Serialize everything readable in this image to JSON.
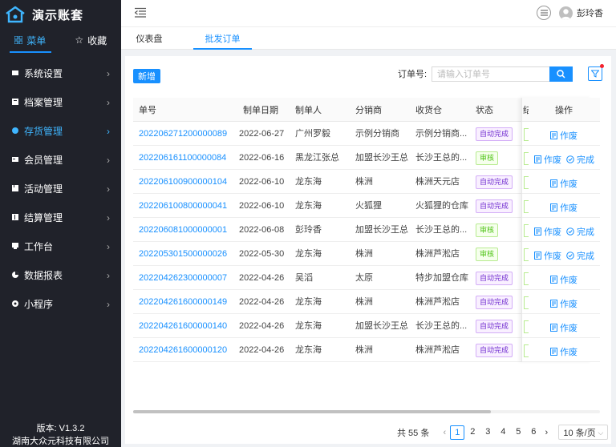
{
  "app": {
    "title": "演示账套"
  },
  "sidebar": {
    "tabs": [
      {
        "label": "菜单",
        "icon": "grid-icon"
      },
      {
        "label": "收藏",
        "icon": "star-icon"
      }
    ],
    "items": [
      {
        "label": "系统设置",
        "icon": "settings-icon"
      },
      {
        "label": "档案管理",
        "icon": "archive-icon"
      },
      {
        "label": "存货管理",
        "icon": "inventory-icon"
      },
      {
        "label": "会员管理",
        "icon": "member-icon"
      },
      {
        "label": "活动管理",
        "icon": "activity-icon"
      },
      {
        "label": "结算管理",
        "icon": "settlement-icon"
      },
      {
        "label": "工作台",
        "icon": "workbench-icon"
      },
      {
        "label": "数据报表",
        "icon": "report-icon"
      },
      {
        "label": "小程序",
        "icon": "miniapp-icon"
      }
    ],
    "active_index": 2,
    "footer": {
      "version": "版本: V1.3.2",
      "company": "湖南大众元科技有限公司"
    }
  },
  "header": {
    "user": "彭玲香"
  },
  "page_tabs": [
    {
      "label": "仪表盘"
    },
    {
      "label": "批发订单"
    }
  ],
  "toolbar": {
    "add_label": "新增",
    "search_label": "订单号:",
    "search_placeholder": "请输入订单号"
  },
  "table": {
    "columns": [
      "单号",
      "制单日期",
      "制单人",
      "分销商",
      "收货仓",
      "状态",
      "操作"
    ],
    "cut_column_glyph": "结",
    "rows": [
      {
        "no": "202206271200000089",
        "date": "2022-06-27",
        "maker": "广州罗毅",
        "dist": "示例分销商",
        "wh": "示例分销商...",
        "status": "自动完成",
        "ops": [
          "作废"
        ]
      },
      {
        "no": "202206161100000084",
        "date": "2022-06-16",
        "maker": "黑龙江张总",
        "dist": "加盟长沙王总",
        "wh": "长沙王总的...",
        "status": "审核",
        "ops": [
          "作废",
          "完成"
        ]
      },
      {
        "no": "202206100900000104",
        "date": "2022-06-10",
        "maker": "龙东海",
        "dist": "株洲",
        "wh": "株洲天元店",
        "status": "自动完成",
        "ops": [
          "作废"
        ]
      },
      {
        "no": "202206100800000041",
        "date": "2022-06-10",
        "maker": "龙东海",
        "dist": "火狐狸",
        "wh": "火狐狸的仓库",
        "status": "自动完成",
        "ops": [
          "作废"
        ]
      },
      {
        "no": "202206081000000001",
        "date": "2022-06-08",
        "maker": "彭玲香",
        "dist": "加盟长沙王总",
        "wh": "长沙王总的...",
        "status": "审核",
        "ops": [
          "作废",
          "完成"
        ]
      },
      {
        "no": "202205301500000026",
        "date": "2022-05-30",
        "maker": "龙东海",
        "dist": "株洲",
        "wh": "株洲芦淞店",
        "status": "审核",
        "ops": [
          "作废",
          "完成"
        ]
      },
      {
        "no": "202204262300000007",
        "date": "2022-04-26",
        "maker": "吴滔",
        "dist": "太原",
        "wh": "特步加盟仓库",
        "status": "自动完成",
        "ops": [
          "作废"
        ]
      },
      {
        "no": "202204261600000149",
        "date": "2022-04-26",
        "maker": "龙东海",
        "dist": "株洲",
        "wh": "株洲芦淞店",
        "status": "自动完成",
        "ops": [
          "作废"
        ]
      },
      {
        "no": "202204261600000140",
        "date": "2022-04-26",
        "maker": "龙东海",
        "dist": "加盟长沙王总",
        "wh": "长沙王总的...",
        "status": "自动完成",
        "ops": [
          "作废"
        ]
      },
      {
        "no": "202204261600000120",
        "date": "2022-04-26",
        "maker": "龙东海",
        "dist": "株洲",
        "wh": "株洲芦淞店",
        "status": "自动完成",
        "ops": [
          "作废"
        ]
      }
    ]
  },
  "pagination": {
    "total": "共 55 条",
    "pages": [
      "1",
      "2",
      "3",
      "4",
      "5",
      "6"
    ],
    "current": "1",
    "page_size": "10 条/页"
  },
  "colors": {
    "accent": "#1890ff",
    "sidebar_bg": "#20222a",
    "auto_badge": "#722ed1",
    "audit_badge": "#52c41a"
  }
}
